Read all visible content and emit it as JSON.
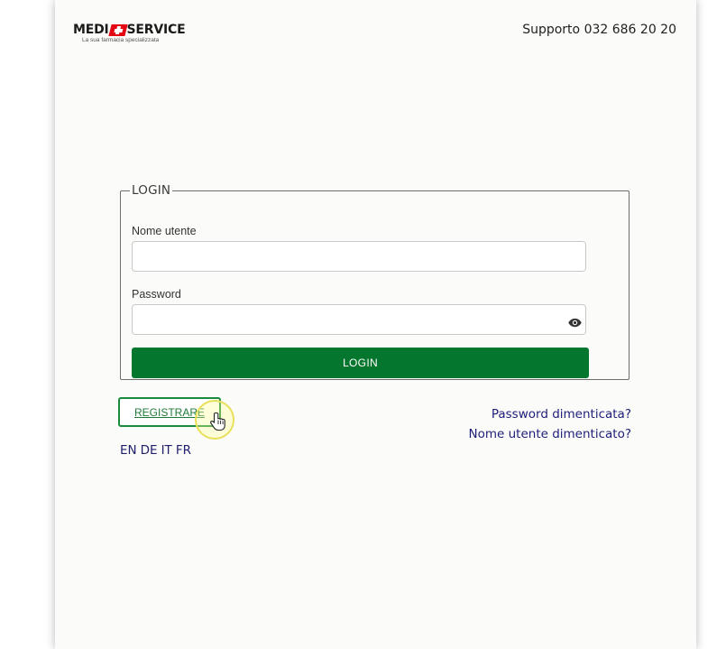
{
  "header": {
    "logo": {
      "brand_left": "MEDI",
      "brand_right": "SERVICE",
      "tagline": "La sua farmacia specializzata"
    },
    "support_text": "Supporto 032 686 20 20"
  },
  "login_form": {
    "legend": "LOGIN",
    "username": {
      "label": "Nome utente",
      "value": "",
      "placeholder": ""
    },
    "password": {
      "label": "Password",
      "value": "",
      "placeholder": ""
    },
    "submit_label": "LOGIN"
  },
  "register_label": "REGISTRARE",
  "languages": [
    "EN",
    "DE",
    "IT",
    "FR"
  ],
  "forgot": {
    "password": "Password dimenticata?",
    "username": "Nome utente dimenticato?"
  },
  "colors": {
    "primary_green": "#05762e",
    "register_border": "#1a8a3c",
    "link_blue": "#1e1e7a",
    "brand_red": "#e30613"
  },
  "icons": {
    "password_toggle": "eye-icon",
    "logo_mark": "swiss-cross-icon",
    "cursor": "hand-pointer-icon"
  }
}
